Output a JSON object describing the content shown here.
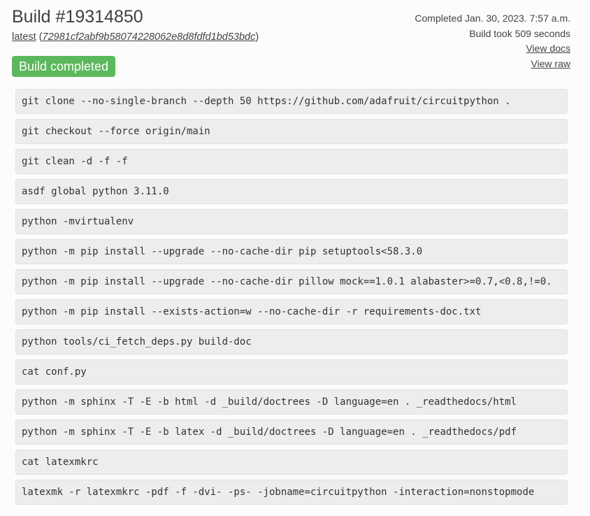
{
  "build": {
    "title": "Build #19314850",
    "version_label": "latest",
    "commit_open": "(",
    "commit": "72981cf2abf9b58074228062e8d8fdfd1bd53bdc",
    "commit_close": ")",
    "status": "Build completed",
    "status_color": "#5cb85c"
  },
  "meta": {
    "completed": "Completed Jan. 30, 2023. 7:57 a.m.",
    "duration": "Build took 509 seconds",
    "view_docs": "View docs",
    "view_raw": "View raw"
  },
  "commands": [
    "git clone --no-single-branch --depth 50 https://github.com/adafruit/circuitpython .",
    "git checkout --force origin/main",
    "git clean -d -f -f",
    "asdf global python 3.11.0",
    "python -mvirtualenv",
    "python -m pip install --upgrade --no-cache-dir pip setuptools<58.3.0",
    "python -m pip install --upgrade --no-cache-dir pillow mock==1.0.1 alabaster>=0.7,<0.8,!=0.",
    "python -m pip install --exists-action=w --no-cache-dir -r requirements-doc.txt",
    "python tools/ci_fetch_deps.py build-doc",
    "cat conf.py",
    "python -m sphinx -T -E -b html -d _build/doctrees -D language=en . _readthedocs/html",
    "python -m sphinx -T -E -b latex -d _build/doctrees -D language=en . _readthedocs/pdf",
    "cat latexmkrc",
    "latexmk -r latexmkrc -pdf -f -dvi- -ps- -jobname=circuitpython -interaction=nonstopmode"
  ]
}
